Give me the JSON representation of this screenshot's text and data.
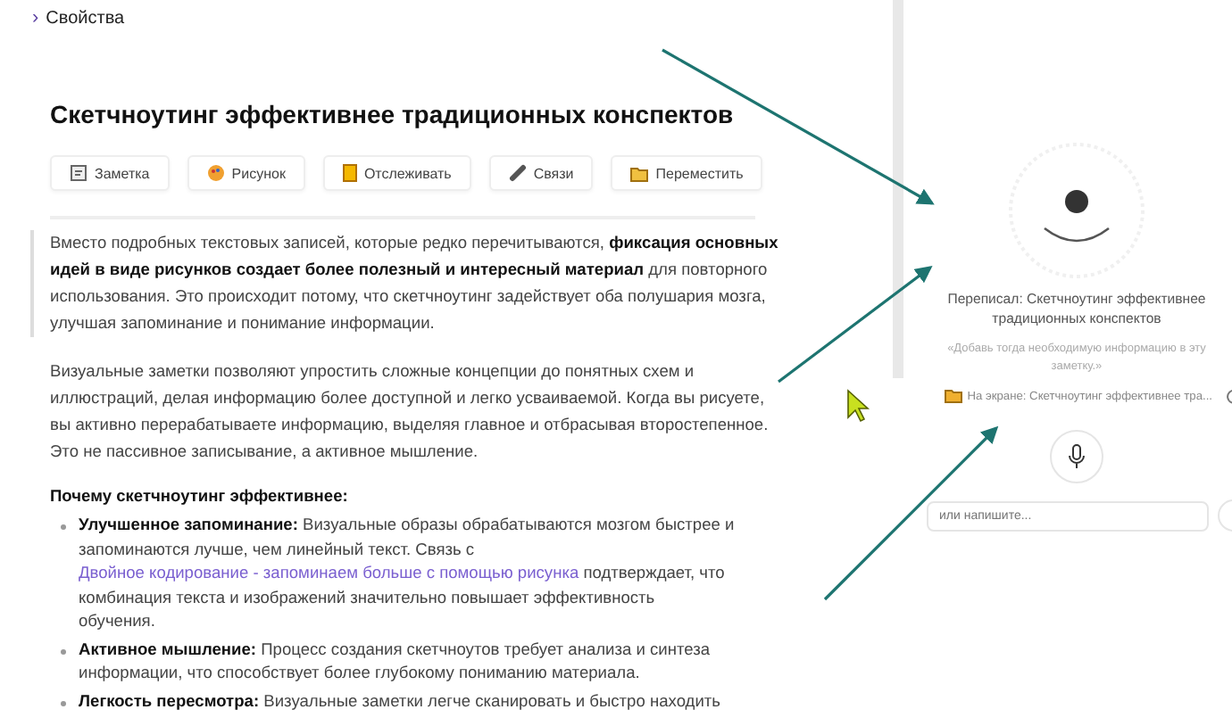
{
  "breadcrumb": {
    "icon": "›",
    "label": "Свойства"
  },
  "title": "Скетчноутинг эффективнее традиционных конспектов",
  "toolbar": [
    {
      "kind": "note",
      "label": "Заметка"
    },
    {
      "kind": "drawing",
      "label": "Рисунок"
    },
    {
      "kind": "track",
      "label": "Отслеживать"
    },
    {
      "kind": "links",
      "label": "Связи"
    },
    {
      "kind": "move",
      "label": "Переместить"
    }
  ],
  "quote": "Вместо подробных текстовых записей, которые редко перечитываются, **фиксация основных идей в виде рисунков создает более полезный и интересный материал** для повторного использования. Это происходит потому, что скетчноутинг задействует оба полушария мозга, улучшая запоминание и понимание информации.",
  "paragraph": "Визуальные заметки позволяют упростить сложные концепции до понятных схем и иллюстраций, делая информацию более доступной и легко усваиваемой. Когда вы рисуете, вы активно перерабатываете информацию, выделяя главное и отбрасывая второстепенное. Это не пассивное записывание, а активное мышление.",
  "list_heading": "Почему скетчноутинг эффективнее:",
  "list_items": [
    {
      "term": "Улучшенное запоминание:",
      "text": "Визуальные образы обрабатываются мозгом быстрее и запоминаются лучше, чем линейный текст. Связь с",
      "link": "Двойное кодирование - запоминаем больше с помощью рисунка",
      "after": "подтверждает, что комбинация текста и изображений значительно повышает эффективность обучения."
    },
    {
      "term": "Активное мышление:",
      "text": "Процесс создания скетчноутов требует анализа и синтеза информации, что способствует более глубокому пониманию материала."
    },
    {
      "term": "Легкость пересмотра:",
      "text": "Визуальные заметки легче сканировать и быстро находить"
    }
  ],
  "assistant": {
    "status": "Переписал: Скетчноутинг эффективнее традиционных конспектов",
    "hint": "«Добавь тогда необходимую информацию в эту заметку.»",
    "context": "На экране: Скетчноутинг эффективнее тра...",
    "input_placeholder": "или напишите..."
  }
}
